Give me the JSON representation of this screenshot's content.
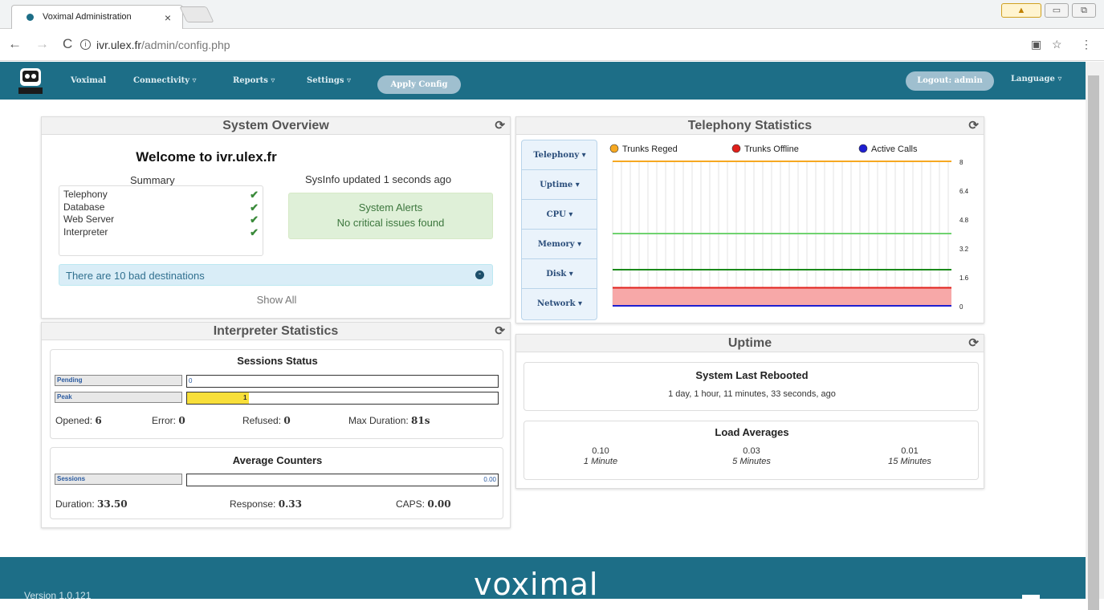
{
  "browser": {
    "tab_title": "Voximal Administration",
    "url_host": "ivr.ulex.fr",
    "url_path": "/admin/config.php"
  },
  "nav": {
    "items": [
      "Voximal",
      "Connectivity ▿",
      "Reports ▿",
      "Settings ▿"
    ],
    "apply": "Apply Config",
    "logout": "Logout: admin",
    "language": "Language ▿"
  },
  "system_overview": {
    "title": "System Overview",
    "welcome": "Welcome to ivr.ulex.fr",
    "summary_label": "Summary",
    "sysinfo": "SysInfo updated 1 seconds ago",
    "summary_items": [
      "Telephony",
      "Database",
      "Web Server",
      "Interpreter"
    ],
    "alerts_title": "System Alerts",
    "alerts_text": "No critical issues found",
    "bad_dest": "There are 10 bad destinations",
    "show_all": "Show All"
  },
  "interpreter": {
    "title": "Interpreter Statistics",
    "sessions_status": "Sessions Status",
    "pending_label": "Pending",
    "pending_value": "0",
    "peak_label": "Peak",
    "peak_value": "1",
    "peak_fill": 0.2,
    "opened_label": "Opened:",
    "opened_value": "6",
    "error_label": "Error:",
    "error_value": "0",
    "refused_label": "Refused:",
    "refused_value": "0",
    "maxdur_label": "Max Duration:",
    "maxdur_value": "81s",
    "avg_title": "Average Counters",
    "sessions_label": "Sessions",
    "sessions_value": "0.00",
    "duration_label": "Duration:",
    "duration_value": "33.50",
    "response_label": "Response:",
    "response_value": "0.33",
    "caps_label": "CAPS:",
    "caps_value": "0.00"
  },
  "telephony": {
    "title": "Telephony Statistics",
    "side_buttons": [
      "Telephony ▾",
      "Uptime ▾",
      "CPU ▾",
      "Memory ▾",
      "Disk ▾",
      "Network ▾"
    ]
  },
  "uptime": {
    "title": "Uptime",
    "rebooted_title": "System Last Rebooted",
    "rebooted_text": "1 day, 1 hour, 11 minutes, 33 seconds, ago",
    "load_title": "Load Averages",
    "loads": [
      {
        "value": "0.10",
        "label": "1 Minute"
      },
      {
        "value": "0.03",
        "label": "5 Minutes"
      },
      {
        "value": "0.01",
        "label": "15 Minutes"
      }
    ]
  },
  "footer": {
    "version": "Version 1.0.121",
    "brand": "voximal"
  },
  "chart_data": {
    "type": "area",
    "legend": [
      "Trunks Reged",
      "Trunks Offline",
      "Active Calls"
    ],
    "colors": [
      "#f6a821",
      "#e0201b",
      "#1f1fd0",
      "#6fd26f",
      "#1a8a1a"
    ],
    "ylim": [
      0,
      8
    ],
    "yticks": [
      "8",
      "6.4",
      "4.8",
      "3.2",
      "1.6",
      "0"
    ],
    "series": [
      {
        "name": "Trunks Reged",
        "values": [
          8
        ]
      },
      {
        "name": "Trunks Offline",
        "values": [
          1
        ]
      },
      {
        "name": "Active Calls",
        "values": [
          0
        ]
      }
    ],
    "other_lines": [
      4,
      2
    ]
  }
}
